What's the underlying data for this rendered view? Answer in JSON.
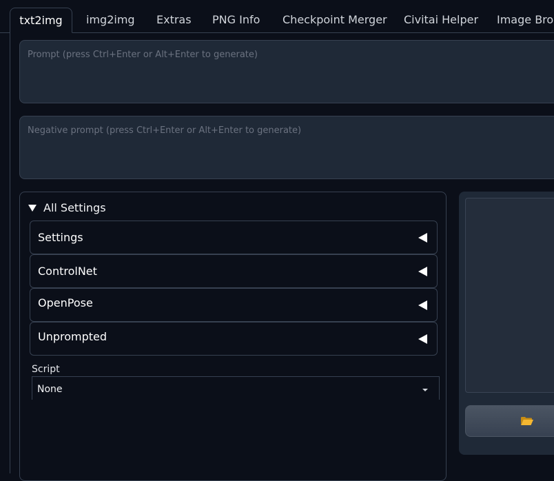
{
  "tabs": [
    {
      "label": "txt2img",
      "active": true
    },
    {
      "label": "img2img",
      "active": false
    },
    {
      "label": "Extras",
      "active": false
    },
    {
      "label": "PNG Info",
      "active": false
    },
    {
      "label": "Checkpoint Merger",
      "active": false
    },
    {
      "label": "Civitai Helper",
      "active": false
    },
    {
      "label": "Image Brow",
      "active": false
    }
  ],
  "prompt": {
    "value": "",
    "placeholder": "Prompt (press Ctrl+Enter or Alt+Enter to generate)"
  },
  "negative_prompt": {
    "value": "",
    "placeholder": "Negative prompt (press Ctrl+Enter or Alt+Enter to generate)"
  },
  "all_settings": {
    "label": "All Settings",
    "expanded": true,
    "sections": [
      {
        "label": "Settings",
        "expanded": false
      },
      {
        "label": "ControlNet",
        "expanded": false
      },
      {
        "label": "OpenPose",
        "expanded": false
      },
      {
        "label": "Unprompted",
        "expanded": false
      }
    ]
  },
  "script": {
    "label": "Script",
    "value": "None"
  },
  "gallery": {
    "folder_button_icon": "open-folder-icon"
  },
  "colors": {
    "background": "#0b0f19",
    "input_background": "#1f2937",
    "border": "#374151",
    "folder_icon": "#f5b731"
  }
}
